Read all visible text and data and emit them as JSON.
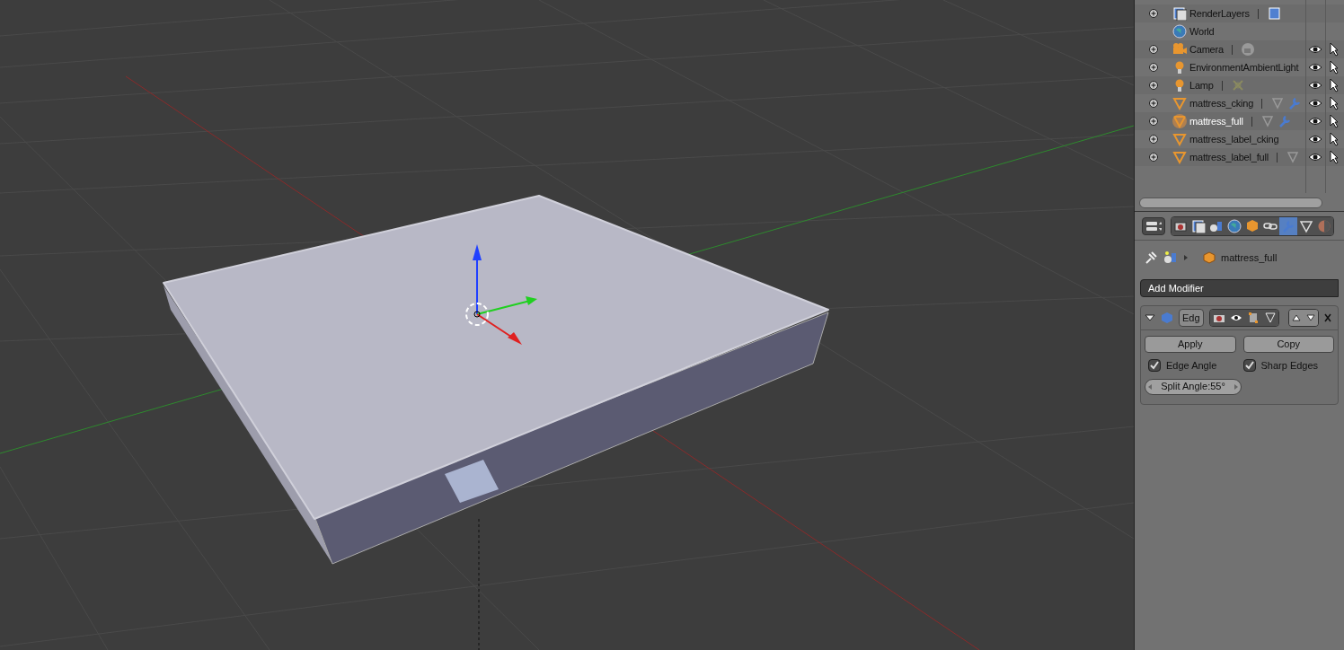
{
  "outliner": {
    "items": [
      {
        "kind": "render-layers",
        "label": "RenderLayers",
        "expandable": true,
        "selected": false,
        "restrict_columns": false,
        "extras": [
          {
            "kind": "render-layer"
          }
        ]
      },
      {
        "kind": "world",
        "label": "World",
        "expandable": false,
        "selected": false,
        "restrict_columns": false
      },
      {
        "kind": "camera",
        "label": "Camera",
        "expandable": true,
        "selected": false,
        "restrict_columns": true,
        "extras": [
          {
            "kind": "camera-data"
          }
        ]
      },
      {
        "kind": "lamp",
        "label": "EnvironmentAmbientLight",
        "expandable": true,
        "selected": false,
        "restrict_columns": true
      },
      {
        "kind": "lamp",
        "label": "Lamp",
        "expandable": true,
        "selected": false,
        "restrict_columns": true,
        "extras": [
          {
            "kind": "lamp-data"
          }
        ]
      },
      {
        "kind": "mesh",
        "label": "mattress_cking",
        "expandable": true,
        "selected": false,
        "restrict_columns": true,
        "extras": [
          {
            "kind": "mesh-data"
          },
          {
            "kind": "modifier"
          }
        ]
      },
      {
        "kind": "mesh",
        "label": "mattress_full",
        "expandable": true,
        "selected": true,
        "restrict_columns": true,
        "extras": [
          {
            "kind": "mesh-data"
          },
          {
            "kind": "modifier"
          }
        ]
      },
      {
        "kind": "mesh",
        "label": "mattress_label_cking",
        "expandable": true,
        "selected": false,
        "restrict_columns": true
      },
      {
        "kind": "mesh",
        "label": "mattress_label_full",
        "expandable": true,
        "selected": false,
        "restrict_columns": true,
        "extras": [
          {
            "kind": "mesh-data"
          }
        ]
      }
    ]
  },
  "properties": {
    "tabs": [
      {
        "kind": "render",
        "selected": false
      },
      {
        "kind": "render-layers",
        "selected": false
      },
      {
        "kind": "scene",
        "selected": false
      },
      {
        "kind": "world",
        "selected": false
      },
      {
        "kind": "object",
        "selected": false
      },
      {
        "kind": "constraints",
        "selected": false
      },
      {
        "kind": "modifier",
        "selected": true
      },
      {
        "kind": "data",
        "selected": false
      },
      {
        "kind": "material",
        "selected": false
      }
    ],
    "breadcrumb": "mattress_full",
    "add_modifier": "Add Modifier",
    "modifier": {
      "name": "Edg",
      "expanded": true,
      "apply": "Apply",
      "copy": "Copy",
      "options": [
        {
          "label": "Edge Angle",
          "checked": true
        },
        {
          "label": "Sharp Edges",
          "checked": true
        }
      ],
      "split_angle": "Split Angle:55°"
    }
  }
}
